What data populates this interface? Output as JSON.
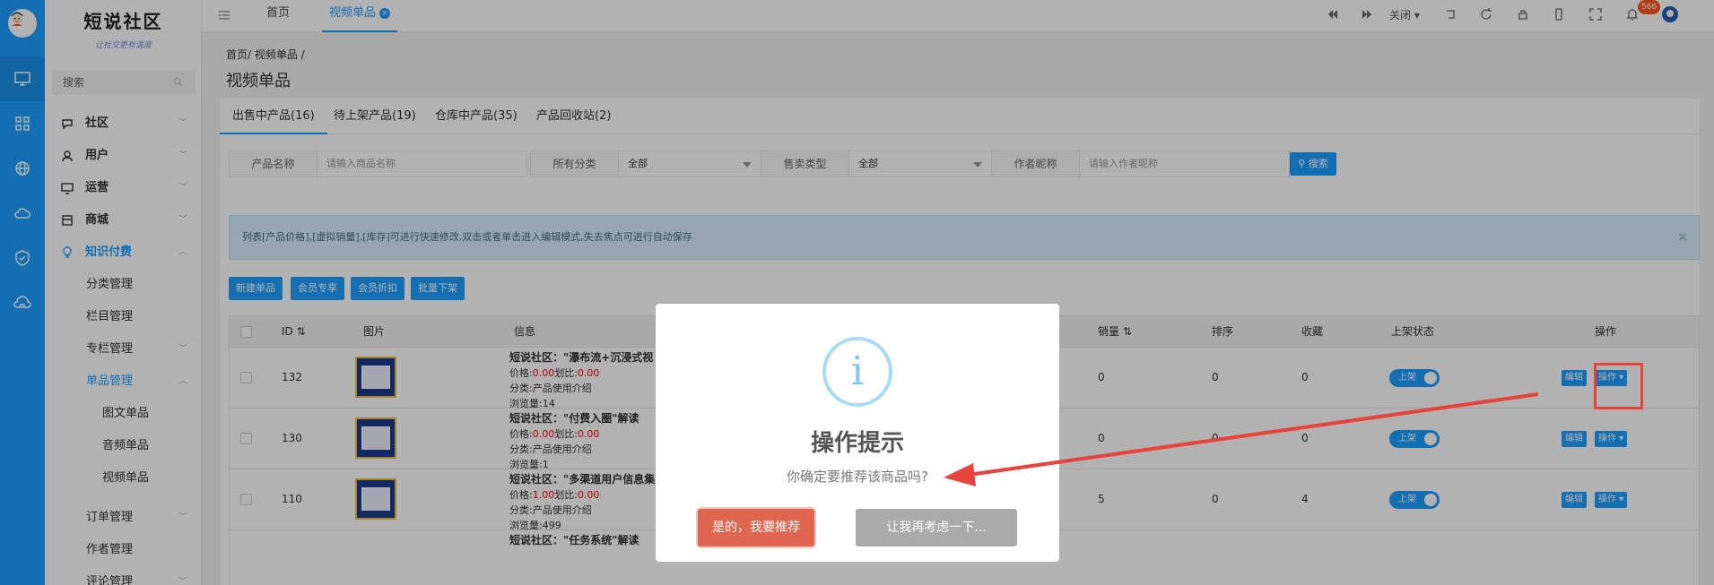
{
  "sidebar_logo": {
    "title": "短说社区",
    "subtitle": "让社交更有温度"
  },
  "sidebar": {
    "search_placeholder": "搜索",
    "menu": [
      {
        "label": "社区",
        "arrow": "﹀"
      },
      {
        "label": "用户",
        "arrow": "﹀"
      },
      {
        "label": "运营",
        "arrow": "﹀"
      },
      {
        "label": "商城",
        "arrow": "﹀"
      },
      {
        "label": "知识付费",
        "arrow": "︿"
      }
    ],
    "sub": [
      {
        "label": "分类管理"
      },
      {
        "label": "栏目管理"
      },
      {
        "label": "专栏管理"
      },
      {
        "label": "单品管理"
      }
    ],
    "sub2": [
      {
        "label": "图文单品"
      },
      {
        "label": "音频单品"
      },
      {
        "label": "视频单品"
      }
    ],
    "more": [
      {
        "label": "订单管理"
      },
      {
        "label": "作者管理"
      },
      {
        "label": "评论管理"
      }
    ]
  },
  "topbar": {
    "tabs": [
      {
        "label": "首页"
      },
      {
        "label": "视频单品"
      }
    ],
    "close_label": "关闭",
    "badge": "566"
  },
  "breadcrumb": "首页/ 视频单品 /",
  "page_title": "视频单品",
  "content_tabs": [
    {
      "label": "出售中产品(16)"
    },
    {
      "label": "待上架产品(19)"
    },
    {
      "label": "仓库中产品(35)"
    },
    {
      "label": "产品回收站(2)"
    }
  ],
  "filters": [
    {
      "label": "产品名称",
      "placeholder": "请输入商品名称"
    },
    {
      "label": "所有分类",
      "value": "全部"
    },
    {
      "label": "售卖类型",
      "value": "全部"
    },
    {
      "label": "作者昵称",
      "placeholder": "请输入作者昵称"
    }
  ],
  "search_button": "搜索",
  "notice": "列表[产品价格],[虚拟销量],[库存]可进行快速修改,双击或者单击进入编辑模式,失去焦点可进行自动保存",
  "actions": [
    "新建单品",
    "会员专享",
    "会员折扣",
    "批量下架"
  ],
  "table": {
    "headers": {
      "id": "ID",
      "image": "图片",
      "info": "信息",
      "sales": "销量",
      "order": "排序",
      "fav": "收藏",
      "status": "上架状态",
      "op": "操作"
    },
    "rows": [
      {
        "id": "132",
        "name": "短说社区：\"瀑布流+沉浸式视",
        "price": "0.00",
        "line_price": "0.00",
        "category": "分类:产品使用介绍",
        "views": "浏览量:14",
        "sales": "0",
        "order": "0",
        "fav": "0",
        "status": "上架"
      },
      {
        "id": "130",
        "name": "短说社区：\"付费入圈\"解读",
        "price": "0.00",
        "line_price": "0.00",
        "category": "分类:产品使用介绍",
        "views": "浏览量:1",
        "sales": "0",
        "order": "0",
        "fav": "0",
        "status": "上架"
      },
      {
        "id": "110",
        "name": "短说社区：\"多渠道用户信息集",
        "price": "1.00",
        "line_price": "0.00",
        "category": "分类:产品使用介绍",
        "views": "浏览量:499",
        "sales": "5",
        "order": "0",
        "fav": "4",
        "status": "上架"
      },
      {
        "id": "",
        "name": "短说社区：\"任务系统\"解读",
        "price": "",
        "line_price": "",
        "category": "",
        "views": "",
        "sales": "",
        "order": "",
        "fav": "",
        "status": ""
      }
    ],
    "price_label": "价格:",
    "line_price_label": "划比:",
    "edit_label": "编辑",
    "op_label": "操作 ▾"
  },
  "dialog": {
    "icon": "i",
    "title": "操作提示",
    "message": "你确定要推荐该商品吗?",
    "confirm": "是的，我要推荐",
    "cancel": "让我再考虑一下..."
  },
  "colors": {
    "primary": "#1e9fff",
    "confirm": "#e06650",
    "annotation": "#e8423d"
  }
}
